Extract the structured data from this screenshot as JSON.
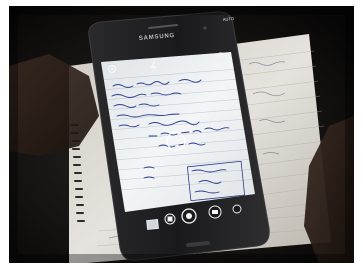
{
  "scene": {
    "description_free": true
  },
  "phone": {
    "brand": "SAMSUNG",
    "top_right_mode": "AUTO"
  },
  "colors": {
    "background_dark": "#0e0d0c",
    "phone_body": "#1c1c1e",
    "screen_light": "#eef2f4",
    "notebook_paper": "#e4e1dc",
    "ink_blue": "#2a3c8c"
  },
  "icons": {
    "settings": "gear-icon",
    "flash": "flash-icon",
    "switch_camera": "switch-camera-icon",
    "gallery": "gallery-thumbnail",
    "shutter": "camera-shutter-icon",
    "record": "record-icon",
    "mode": "mode-icon"
  }
}
